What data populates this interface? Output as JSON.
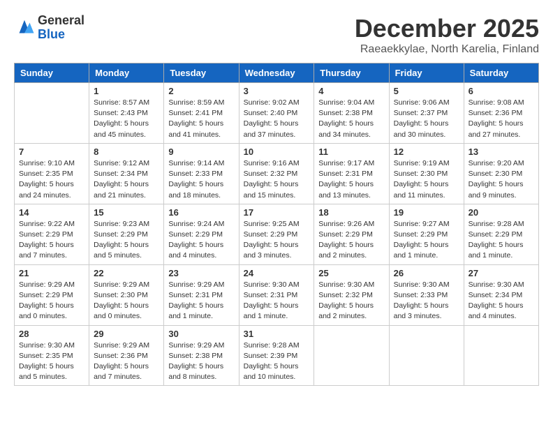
{
  "header": {
    "logo": {
      "general": "General",
      "blue": "Blue"
    },
    "month": "December 2025",
    "location": "Raeaekkylae, North Karelia, Finland"
  },
  "weekdays": [
    "Sunday",
    "Monday",
    "Tuesday",
    "Wednesday",
    "Thursday",
    "Friday",
    "Saturday"
  ],
  "weeks": [
    [
      {
        "day": "",
        "info": ""
      },
      {
        "day": "1",
        "info": "Sunrise: 8:57 AM\nSunset: 2:43 PM\nDaylight: 5 hours\nand 45 minutes."
      },
      {
        "day": "2",
        "info": "Sunrise: 8:59 AM\nSunset: 2:41 PM\nDaylight: 5 hours\nand 41 minutes."
      },
      {
        "day": "3",
        "info": "Sunrise: 9:02 AM\nSunset: 2:40 PM\nDaylight: 5 hours\nand 37 minutes."
      },
      {
        "day": "4",
        "info": "Sunrise: 9:04 AM\nSunset: 2:38 PM\nDaylight: 5 hours\nand 34 minutes."
      },
      {
        "day": "5",
        "info": "Sunrise: 9:06 AM\nSunset: 2:37 PM\nDaylight: 5 hours\nand 30 minutes."
      },
      {
        "day": "6",
        "info": "Sunrise: 9:08 AM\nSunset: 2:36 PM\nDaylight: 5 hours\nand 27 minutes."
      }
    ],
    [
      {
        "day": "7",
        "info": "Sunrise: 9:10 AM\nSunset: 2:35 PM\nDaylight: 5 hours\nand 24 minutes."
      },
      {
        "day": "8",
        "info": "Sunrise: 9:12 AM\nSunset: 2:34 PM\nDaylight: 5 hours\nand 21 minutes."
      },
      {
        "day": "9",
        "info": "Sunrise: 9:14 AM\nSunset: 2:33 PM\nDaylight: 5 hours\nand 18 minutes."
      },
      {
        "day": "10",
        "info": "Sunrise: 9:16 AM\nSunset: 2:32 PM\nDaylight: 5 hours\nand 15 minutes."
      },
      {
        "day": "11",
        "info": "Sunrise: 9:17 AM\nSunset: 2:31 PM\nDaylight: 5 hours\nand 13 minutes."
      },
      {
        "day": "12",
        "info": "Sunrise: 9:19 AM\nSunset: 2:30 PM\nDaylight: 5 hours\nand 11 minutes."
      },
      {
        "day": "13",
        "info": "Sunrise: 9:20 AM\nSunset: 2:30 PM\nDaylight: 5 hours\nand 9 minutes."
      }
    ],
    [
      {
        "day": "14",
        "info": "Sunrise: 9:22 AM\nSunset: 2:29 PM\nDaylight: 5 hours\nand 7 minutes."
      },
      {
        "day": "15",
        "info": "Sunrise: 9:23 AM\nSunset: 2:29 PM\nDaylight: 5 hours\nand 5 minutes."
      },
      {
        "day": "16",
        "info": "Sunrise: 9:24 AM\nSunset: 2:29 PM\nDaylight: 5 hours\nand 4 minutes."
      },
      {
        "day": "17",
        "info": "Sunrise: 9:25 AM\nSunset: 2:29 PM\nDaylight: 5 hours\nand 3 minutes."
      },
      {
        "day": "18",
        "info": "Sunrise: 9:26 AM\nSunset: 2:29 PM\nDaylight: 5 hours\nand 2 minutes."
      },
      {
        "day": "19",
        "info": "Sunrise: 9:27 AM\nSunset: 2:29 PM\nDaylight: 5 hours\nand 1 minute."
      },
      {
        "day": "20",
        "info": "Sunrise: 9:28 AM\nSunset: 2:29 PM\nDaylight: 5 hours\nand 1 minute."
      }
    ],
    [
      {
        "day": "21",
        "info": "Sunrise: 9:29 AM\nSunset: 2:29 PM\nDaylight: 5 hours\nand 0 minutes."
      },
      {
        "day": "22",
        "info": "Sunrise: 9:29 AM\nSunset: 2:30 PM\nDaylight: 5 hours\nand 0 minutes."
      },
      {
        "day": "23",
        "info": "Sunrise: 9:29 AM\nSunset: 2:31 PM\nDaylight: 5 hours\nand 1 minute."
      },
      {
        "day": "24",
        "info": "Sunrise: 9:30 AM\nSunset: 2:31 PM\nDaylight: 5 hours\nand 1 minute."
      },
      {
        "day": "25",
        "info": "Sunrise: 9:30 AM\nSunset: 2:32 PM\nDaylight: 5 hours\nand 2 minutes."
      },
      {
        "day": "26",
        "info": "Sunrise: 9:30 AM\nSunset: 2:33 PM\nDaylight: 5 hours\nand 3 minutes."
      },
      {
        "day": "27",
        "info": "Sunrise: 9:30 AM\nSunset: 2:34 PM\nDaylight: 5 hours\nand 4 minutes."
      }
    ],
    [
      {
        "day": "28",
        "info": "Sunrise: 9:30 AM\nSunset: 2:35 PM\nDaylight: 5 hours\nand 5 minutes."
      },
      {
        "day": "29",
        "info": "Sunrise: 9:29 AM\nSunset: 2:36 PM\nDaylight: 5 hours\nand 7 minutes."
      },
      {
        "day": "30",
        "info": "Sunrise: 9:29 AM\nSunset: 2:38 PM\nDaylight: 5 hours\nand 8 minutes."
      },
      {
        "day": "31",
        "info": "Sunrise: 9:28 AM\nSunset: 2:39 PM\nDaylight: 5 hours\nand 10 minutes."
      },
      {
        "day": "",
        "info": ""
      },
      {
        "day": "",
        "info": ""
      },
      {
        "day": "",
        "info": ""
      }
    ]
  ]
}
